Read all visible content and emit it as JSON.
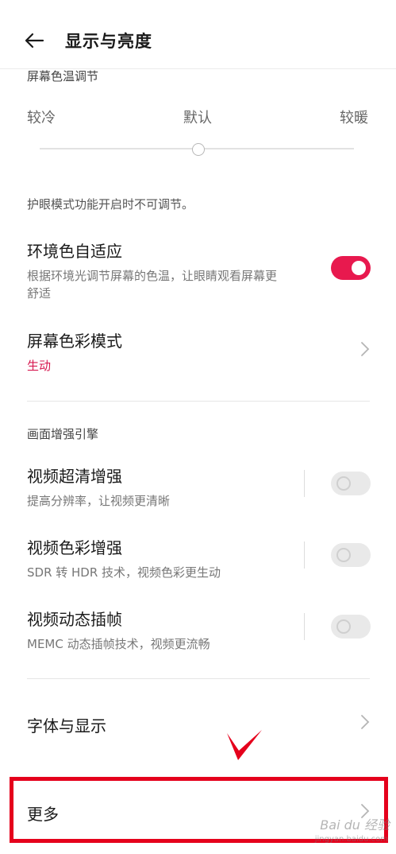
{
  "header": {
    "title": "显示与亮度"
  },
  "color_temp": {
    "section_label": "屏幕色温调节",
    "cool_label": "较冷",
    "default_label": "默认",
    "warm_label": "较暖",
    "slider_position": 0.5
  },
  "eye_note": "护眼模式功能开启时不可调节。",
  "adaptive": {
    "title": "环境色自适应",
    "sub_line1": "根据环境光调节屏幕的色温，让眼睛观看屏幕更",
    "sub_line2": "舒适",
    "enabled": true
  },
  "color_mode": {
    "title": "屏幕色彩模式",
    "value": "生动"
  },
  "engine": {
    "section_label": "画面增强引擎",
    "items": [
      {
        "title": "视频超清增强",
        "sub": "提高分辨率，让视频更清晰",
        "enabled": false
      },
      {
        "title": "视频色彩增强",
        "sub": "SDR 转 HDR 技术，视频色彩更生动",
        "enabled": false
      },
      {
        "title": "视频动态插帧",
        "sub": "MEMC 动态插帧技术，视频更流畅",
        "enabled": false
      }
    ]
  },
  "font_display": {
    "title": "字体与显示"
  },
  "more": {
    "title": "更多"
  },
  "watermark": {
    "text": "Bai du 经验",
    "url": "jingyan.baidu.com"
  },
  "colors": {
    "accent": "#e8194e",
    "value_red": "#d6174f",
    "annotation_red": "#e5001c"
  }
}
